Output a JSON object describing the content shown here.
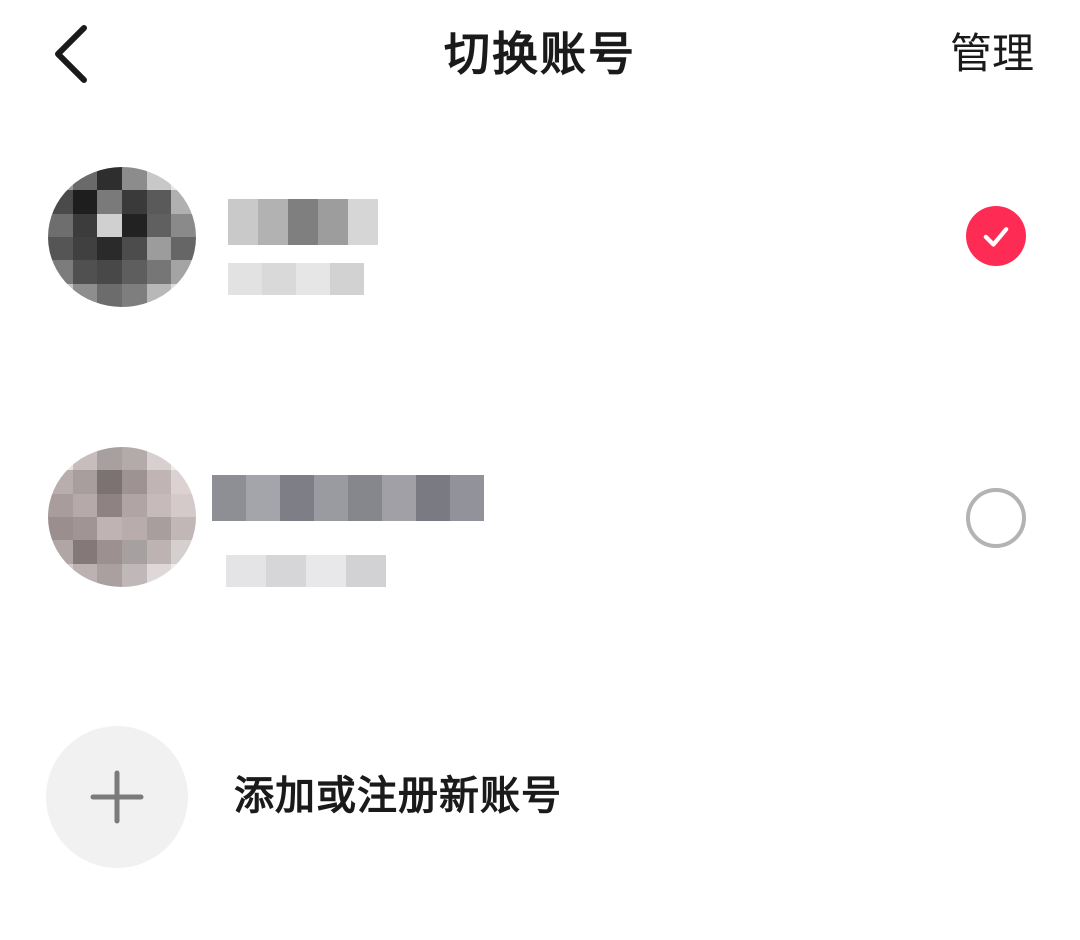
{
  "header": {
    "back_icon": "chevron-left-icon",
    "title": "切换账号",
    "manage_label": "管理"
  },
  "accounts": [
    {
      "selected": true,
      "status_icon": "check-circle-icon"
    },
    {
      "selected": false,
      "status_icon": "empty-circle-icon"
    }
  ],
  "add_account": {
    "icon": "plus-icon",
    "label": "添加或注册新账号"
  },
  "colors": {
    "accent": "#fe2c55",
    "radio_border": "#b3b3b3",
    "add_circle_bg": "#f1f1f2",
    "text": "#1a1a1a"
  }
}
